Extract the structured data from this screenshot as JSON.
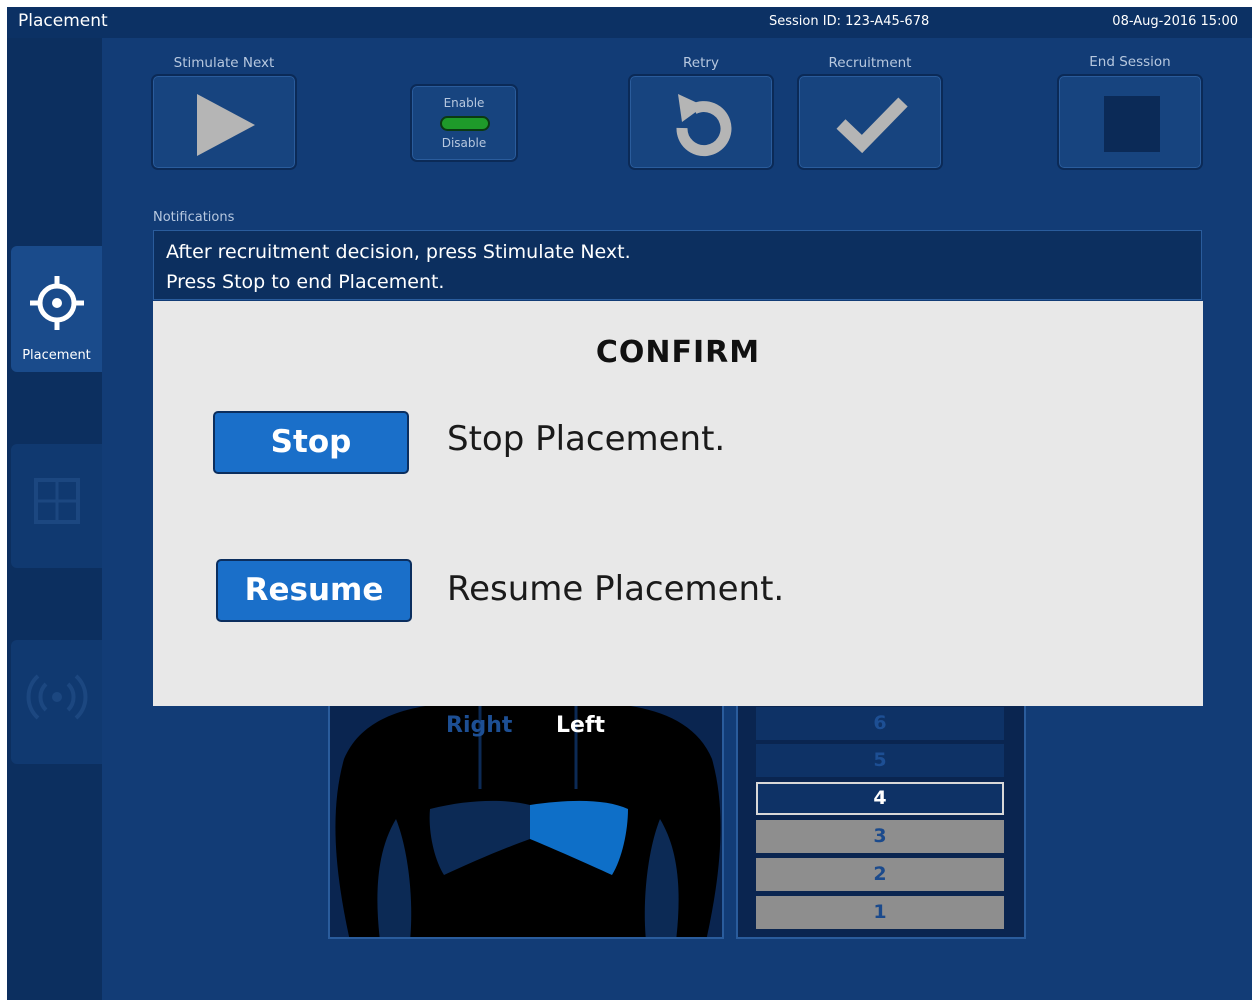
{
  "window": {
    "title": "Placement",
    "session_id": "Session ID: 123-A45-678",
    "datetime": "08-Aug-2016  15:00"
  },
  "sidebar": {
    "items": [
      {
        "label": "Placement",
        "icon": "crosshair-icon",
        "active": true
      },
      {
        "label": "",
        "icon": "grid-icon",
        "active": false
      },
      {
        "label": "",
        "icon": "signal-icon",
        "active": false
      }
    ]
  },
  "toolbar": {
    "stimulate_next": {
      "label": "Stimulate Next",
      "icon": "play-icon"
    },
    "toggle": {
      "enable_label": "Enable",
      "disable_label": "Disable",
      "state": "enabled"
    },
    "retry": {
      "label": "Retry",
      "icon": "retry-icon"
    },
    "recruitment": {
      "label": "Recruitment",
      "icon": "checkmark-icon"
    },
    "end_session": {
      "label": "End Session",
      "icon": "stop-square-icon"
    }
  },
  "notifications": {
    "label": "Notifications",
    "lines": [
      "After recruitment decision, press Stimulate Next.",
      "Press Stop to end Placement."
    ]
  },
  "torso": {
    "right_label": "Right",
    "left_label": "Left",
    "highlighted_side": "left"
  },
  "levels": {
    "items": [
      {
        "label": "6",
        "state": "dim"
      },
      {
        "label": "5",
        "state": "dim"
      },
      {
        "label": "4",
        "state": "selected"
      },
      {
        "label": "3",
        "state": "grey"
      },
      {
        "label": "2",
        "state": "grey"
      },
      {
        "label": "1",
        "state": "grey"
      }
    ]
  },
  "modal": {
    "title": "CONFIRM",
    "stop_button": "Stop",
    "stop_description": "Stop Placement.",
    "resume_button": "Resume",
    "resume_description": "Resume Placement."
  },
  "colors": {
    "background": "#123c76",
    "title_bar": "#0c3164",
    "accent_button": "#1a6fc9",
    "toggle_green": "#1e9a2a",
    "modal_background": "#e8e8e8",
    "lung_highlight": "#0e6fc8"
  }
}
